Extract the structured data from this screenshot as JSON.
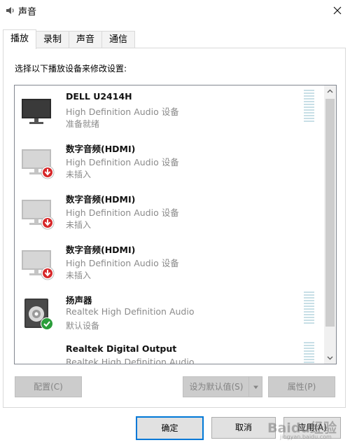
{
  "window": {
    "title": "声音"
  },
  "tabs": [
    {
      "label": "播放",
      "active": true
    },
    {
      "label": "录制",
      "active": false
    },
    {
      "label": "声音",
      "active": false
    },
    {
      "label": "通信",
      "active": false
    }
  ],
  "instruction": "选择以下播放设备来修改设置:",
  "devices": [
    {
      "name": "DELL U2414H",
      "desc": "High Definition Audio 设备",
      "status": "准备就绪",
      "icon": "monitor-icon",
      "badge": "none"
    },
    {
      "name": "数字音频(HDMI)",
      "desc": "High Definition Audio 设备",
      "status": "未插入",
      "icon": "monitor-disconnected-icon",
      "badge": "red-down-arrow"
    },
    {
      "name": "数字音频(HDMI)",
      "desc": "High Definition Audio 设备",
      "status": "未插入",
      "icon": "monitor-disconnected-icon",
      "badge": "red-down-arrow"
    },
    {
      "name": "数字音频(HDMI)",
      "desc": "High Definition Audio 设备",
      "status": "未插入",
      "icon": "monitor-disconnected-icon",
      "badge": "red-down-arrow"
    },
    {
      "name": "扬声器",
      "desc": "Realtek High Definition Audio",
      "status": "默认设备",
      "icon": "speaker-icon",
      "badge": "green-check"
    },
    {
      "name": "Realtek Digital Output",
      "desc": "Realtek High Definition Audio",
      "status": "",
      "icon": "digital-output-icon",
      "badge": "none"
    }
  ],
  "buttons": {
    "configure": "配置(C)",
    "set_default": "设为默认值(S)",
    "properties": "属性(P)",
    "ok": "确定",
    "cancel": "取消",
    "apply": "应用(A)"
  },
  "watermark": {
    "text": "Baidu经验",
    "url": "jingyan.baidu.com"
  },
  "colors": {
    "accent": "#0078d7",
    "badge_red": "#d7282a",
    "badge_green": "#2a9d3a",
    "level_meter": "#c8dfe6"
  }
}
